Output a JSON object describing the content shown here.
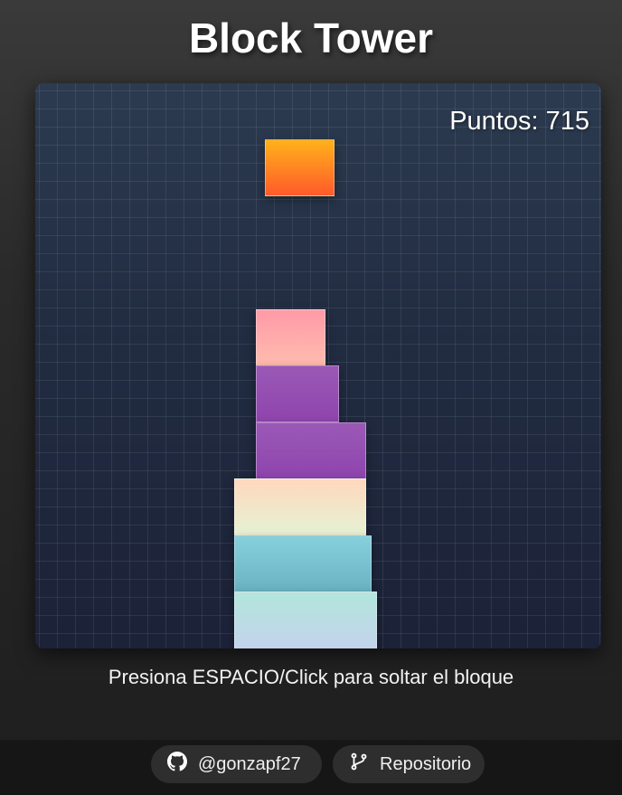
{
  "title": "Block Tower",
  "game": {
    "score_label": "Puntos: 715",
    "score": 715,
    "blocks": [
      {
        "name": "moving-block",
        "colors": [
          "#ffb21a",
          "#ff5a2a"
        ]
      },
      {
        "name": "tower-block-6",
        "colors": [
          "#ff9aa8",
          "#ffbcae"
        ]
      },
      {
        "name": "tower-block-5",
        "colors": [
          "#9b59b6",
          "#8e44ad"
        ]
      },
      {
        "name": "tower-block-4",
        "colors": [
          "#9b59b6",
          "#8e44ad"
        ]
      },
      {
        "name": "tower-block-3",
        "colors": [
          "#ffd8bd",
          "#e6f2d4"
        ]
      },
      {
        "name": "tower-block-2",
        "colors": [
          "#86d0dc",
          "#6ab2c2"
        ]
      },
      {
        "name": "tower-block-1",
        "colors": [
          "#b2e6dc",
          "#c4d2ec"
        ]
      }
    ]
  },
  "instructions": "Presiona ESPACIO/Click para soltar el bloque",
  "footer": {
    "github": {
      "label": "@gonzapf27",
      "icon": "github-icon"
    },
    "repo": {
      "label": "Repositorio",
      "icon": "git-branch-icon"
    }
  }
}
